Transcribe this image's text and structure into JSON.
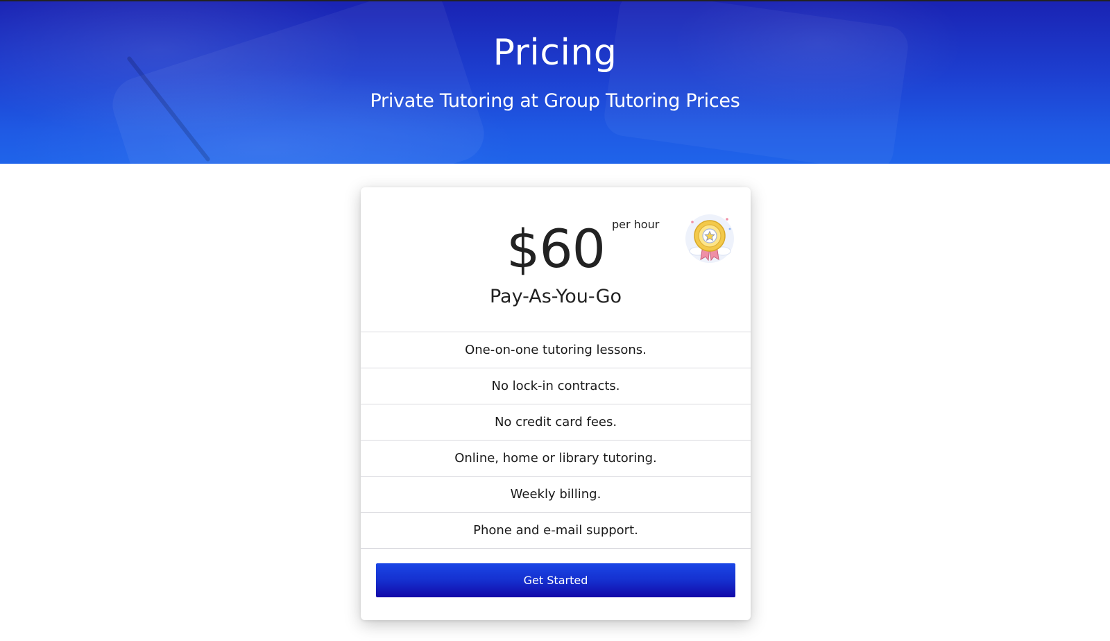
{
  "hero": {
    "title": "Pricing",
    "subtitle": "Private Tutoring at Group Tutoring Prices"
  },
  "plan": {
    "price": "$60",
    "price_unit": "per hour",
    "name": "Pay-As-You-Go",
    "badge_icon": "award-medal-icon",
    "features": [
      "One-on-one tutoring lessons.",
      "No lock-in contracts.",
      "No credit card fees.",
      "Online, home or library tutoring.",
      "Weekly billing.",
      "Phone and e-mail support."
    ],
    "cta_label": "Get Started"
  },
  "colors": {
    "hero_top": "#1a23b3",
    "hero_bottom": "#1f64ea",
    "cta_top": "#1a46e6",
    "cta_bottom": "#1209a8"
  }
}
